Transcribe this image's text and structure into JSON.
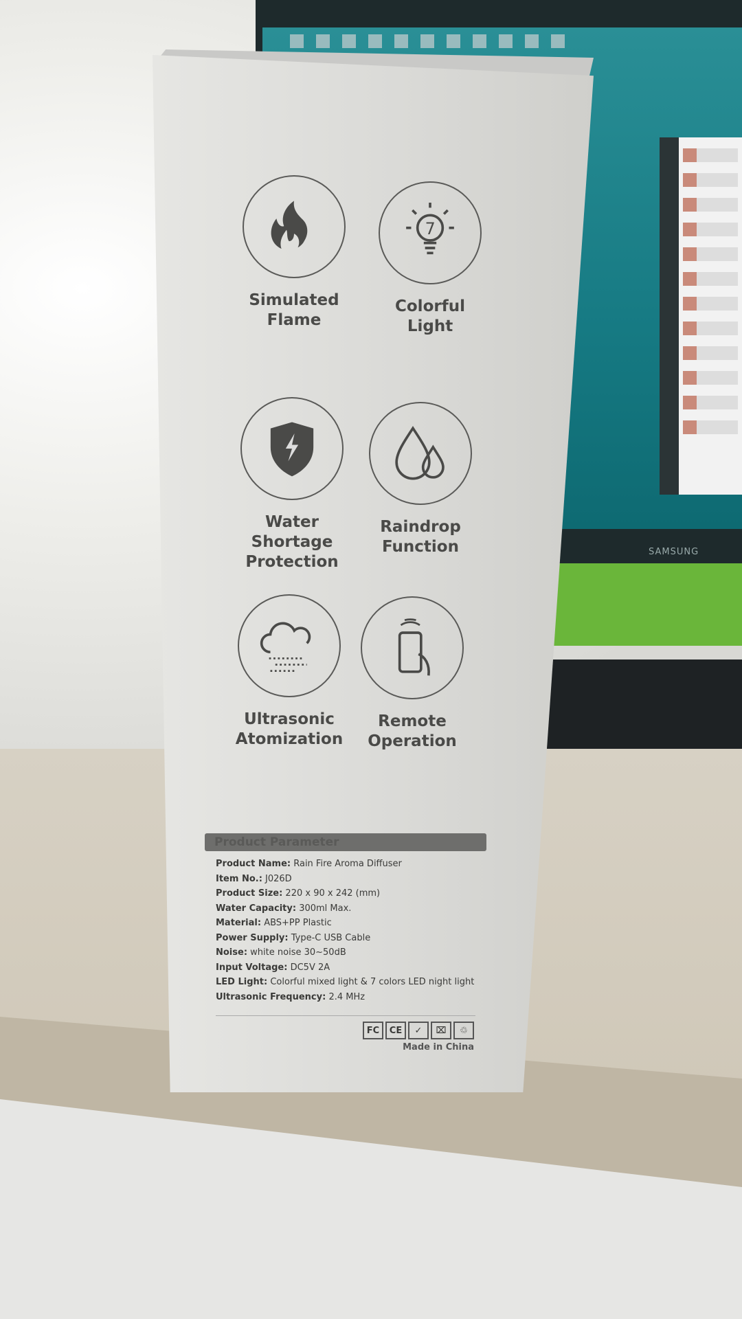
{
  "monitor_brand": "SAMSUNG",
  "features": [
    {
      "label_line1": "Simulated",
      "label_line2": "Flame",
      "icon": "flame-icon"
    },
    {
      "label_line1": "Colorful",
      "label_line2": "Light",
      "icon": "lightbulb-7-icon"
    },
    {
      "label_line1": "Water Shortage",
      "label_line2": "Protection",
      "icon": "shield-lightning-icon"
    },
    {
      "label_line1": "Raindrop",
      "label_line2": "Function",
      "icon": "water-drops-icon"
    },
    {
      "label_line1": "Ultrasonic",
      "label_line2": "Atomization",
      "icon": "cloud-mist-icon"
    },
    {
      "label_line1": "Remote",
      "label_line2": "Operation",
      "icon": "remote-control-icon"
    }
  ],
  "parameters": {
    "title": "Product Parameter",
    "rows": [
      {
        "key": "Product Name:",
        "value": "Rain Fire Aroma Diffuser"
      },
      {
        "key": "Item No.:",
        "value": "J026D"
      },
      {
        "key": "Product Size:",
        "value": "220 x 90 x 242  (mm)"
      },
      {
        "key": "Water Capacity:",
        "value": "300ml Max."
      },
      {
        "key": "Material:",
        "value": "ABS+PP Plastic"
      },
      {
        "key": "Power Supply:",
        "value": "Type-C USB Cable"
      },
      {
        "key": "Noise:",
        "value": "white noise 30~50dB"
      },
      {
        "key": "Input Voltage:",
        "value": "DC5V 2A"
      },
      {
        "key": "LED Light:",
        "value": "Colorful mixed light & 7 colors LED night light"
      },
      {
        "key": "Ultrasonic Frequency:",
        "value": "2.4 MHz"
      }
    ],
    "certifications": [
      "FC",
      "CE",
      "✓",
      "⌧",
      "♲"
    ],
    "origin": "Made in China"
  }
}
